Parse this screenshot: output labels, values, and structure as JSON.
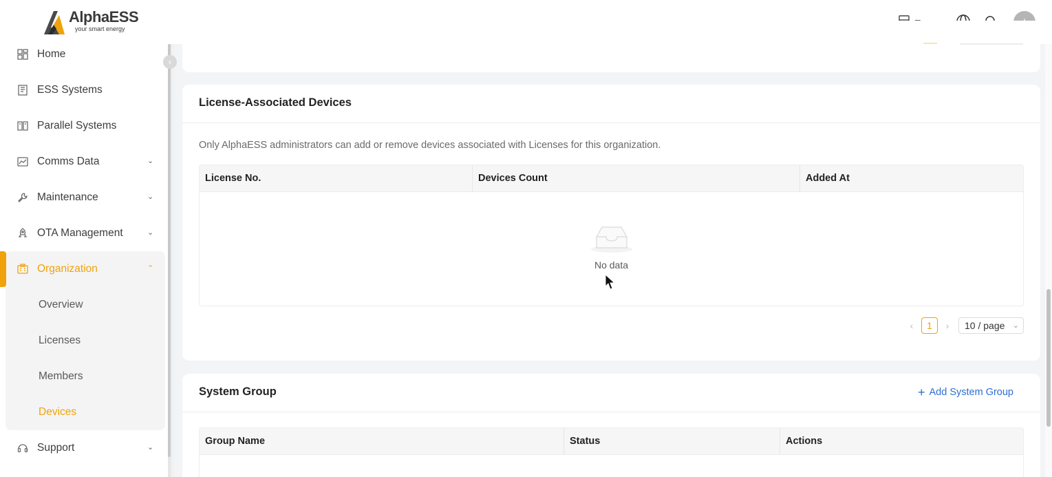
{
  "brand": {
    "name": "AlphaESS",
    "tagline": "your smart energy",
    "accent": "#f0a20b"
  },
  "header": {
    "region": "Europe",
    "avatar_initial": "I",
    "icons": [
      "server-icon",
      "globe-icon",
      "bell-icon"
    ]
  },
  "sidebar": {
    "items": [
      {
        "label": "Home",
        "icon": "dashboard-icon"
      },
      {
        "label": "ESS Systems",
        "icon": "building-icon"
      },
      {
        "label": "Parallel Systems",
        "icon": "book-icon"
      },
      {
        "label": "Comms Data",
        "icon": "chart-icon",
        "expandable": true
      },
      {
        "label": "Maintenance",
        "icon": "wrench-icon",
        "expandable": true
      },
      {
        "label": "OTA Management",
        "icon": "rocket-icon",
        "expandable": true
      },
      {
        "label": "Organization",
        "icon": "org-icon",
        "expandable": true,
        "expanded": true,
        "active": true
      },
      {
        "label": "Support",
        "icon": "headset-icon",
        "expandable": true
      }
    ],
    "org_sub": [
      "Overview",
      "Licenses",
      "Members",
      "Devices"
    ],
    "current_sub": "Devices"
  },
  "license_card": {
    "title": "License-Associated Devices",
    "info": "Only AlphaESS administrators can add or remove devices associated with Licenses for this organization.",
    "columns": [
      "License No.",
      "Devices Count",
      "Added At"
    ],
    "empty_text": "No data",
    "pager": {
      "current_page": "1",
      "page_size": "10 / page"
    }
  },
  "group_card": {
    "title": "System Group",
    "add_label": "Add System Group",
    "columns": [
      "Group Name",
      "Status",
      "Actions"
    ]
  }
}
